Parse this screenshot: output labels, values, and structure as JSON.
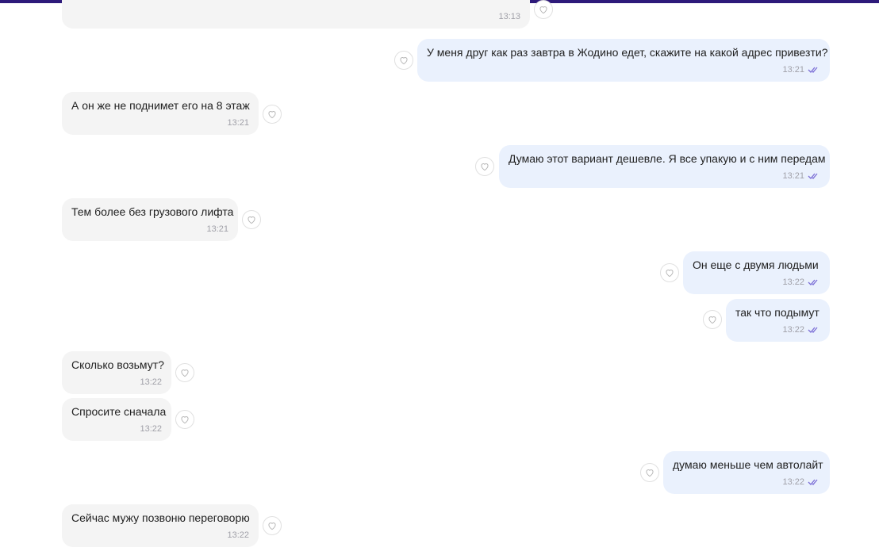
{
  "theme": {
    "top_bar": "#2e1a7a",
    "incoming_bg": "#f4f4f4",
    "outgoing_bg": "#eaf1fd",
    "check_color": "#7c6fd6"
  },
  "messages": [
    {
      "direction": "in",
      "text": "",
      "time": "13:13"
    },
    {
      "direction": "out",
      "text": "У меня друг как раз завтра в Жодино едет, скажите на какой адрес привезти?",
      "time": "13:21"
    },
    {
      "direction": "in",
      "text": "А он же не поднимет его на 8 этаж",
      "time": "13:21"
    },
    {
      "direction": "out",
      "text": "Думаю этот вариант дешевле.  Я все упакую и с ним передам",
      "time": "13:21"
    },
    {
      "direction": "in",
      "text": "Тем более без грузового лифта",
      "time": "13:21"
    },
    {
      "direction": "out",
      "text": "Он еще с двумя  людьми",
      "time": "13:22"
    },
    {
      "direction": "out",
      "text": "так что подымут",
      "time": "13:22"
    },
    {
      "direction": "in",
      "text": "Сколько возьмут?",
      "time": "13:22"
    },
    {
      "direction": "in",
      "text": "Спросите сначала",
      "time": "13:22"
    },
    {
      "direction": "out",
      "text": "думаю меньше чем автолайт",
      "time": "13:22"
    },
    {
      "direction": "in",
      "text": "Сейчас мужу позвоню переговорю",
      "time": "13:22"
    }
  ],
  "icons": {
    "reaction": "heart-icon",
    "read_receipt": "double-check-icon"
  }
}
